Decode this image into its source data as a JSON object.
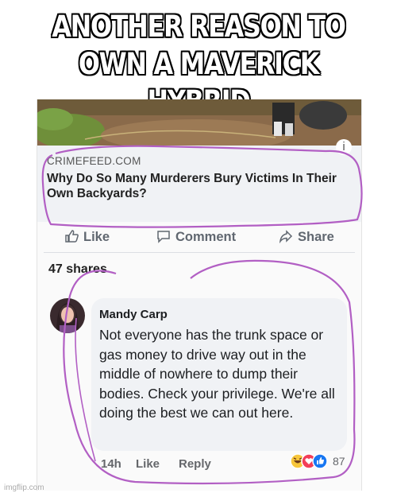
{
  "meme": {
    "caption_line1": "ANOTHER REASON TO",
    "caption_line2": "OWN A MAVERICK HYBRID",
    "watermark": "imgflip.com"
  },
  "post": {
    "source": "CRIMEFEED.COM",
    "headline": "Why Do So Many Murderers Bury Victims In Their Own Backyards?",
    "more_icon": "i",
    "actions": {
      "like": "Like",
      "comment": "Comment",
      "share": "Share"
    },
    "shares": "47 shares"
  },
  "comment": {
    "author": "Mandy Carp",
    "text": "Not everyone has the trunk space or gas money to drive way out in the middle of nowhere to dump their bodies. Check your privilege. We're all doing the best we can out here.",
    "time": "14h",
    "like": "Like",
    "reply": "Reply",
    "reaction_count": "87",
    "reaction_icons": [
      "haha-icon",
      "love-icon",
      "like-icon"
    ]
  },
  "colors": {
    "annotation": "#b25fc4",
    "facebook_gray": "#606770"
  }
}
